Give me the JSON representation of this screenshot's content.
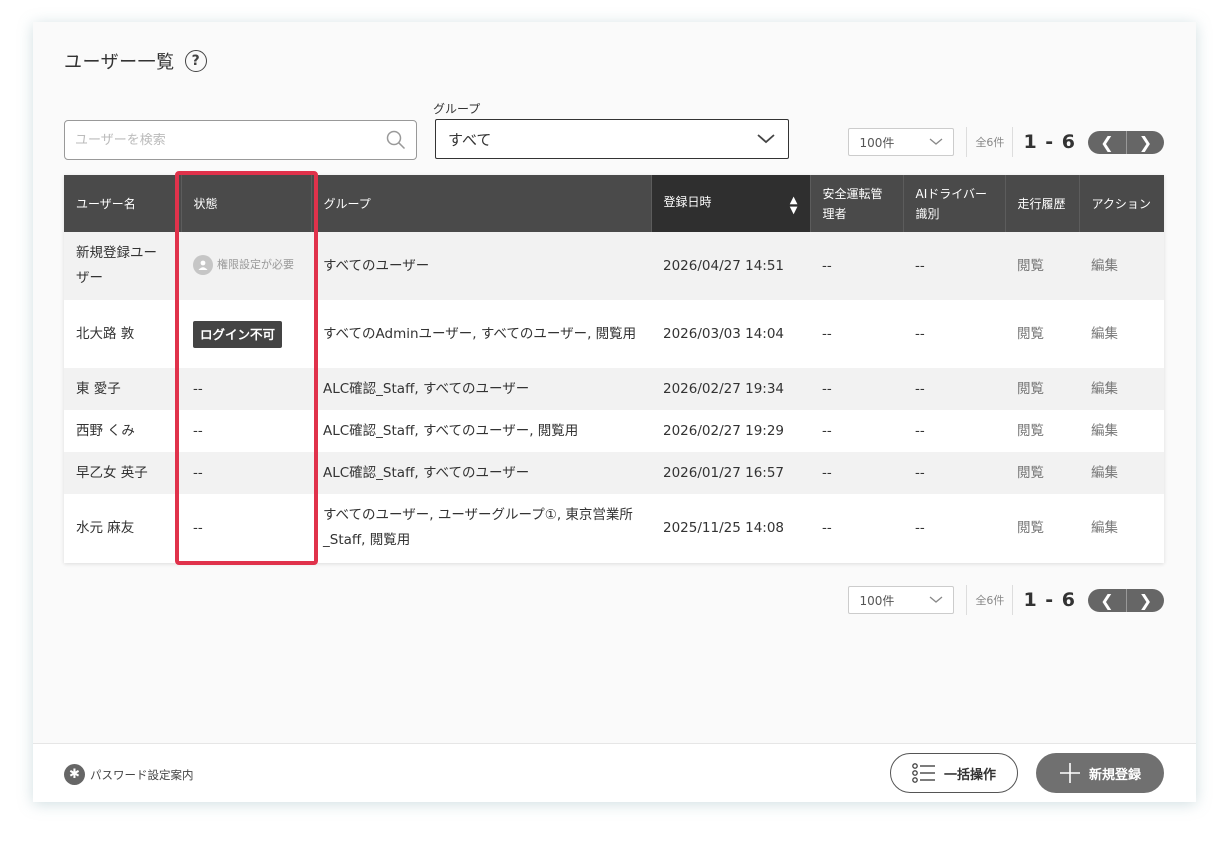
{
  "header": {
    "title": "ユーザー一覧",
    "help_icon": "?"
  },
  "search": {
    "placeholder": "ユーザーを検索"
  },
  "group_filter": {
    "label": "グループ",
    "value": "すべて"
  },
  "pager": {
    "per_page": "100件",
    "total": "全6件",
    "range": "1 - 6",
    "prev": "❮",
    "next": "❯"
  },
  "table": {
    "columns": [
      "ユーザー名",
      "状態",
      "グループ",
      "登録日時",
      "安全運転管理者",
      "AIドライバー識別",
      "走行履歴",
      "アクション"
    ],
    "rows": [
      {
        "name": "新規登録ユーザー",
        "status": "権限設定が必要",
        "group": "すべてのユーザー",
        "date": "2026/04/27 14:51",
        "safety": "--",
        "ai": "--",
        "history": "閲覧",
        "action": "編集"
      },
      {
        "name": "北大路 敦",
        "status": "ログイン不可",
        "group": "すべてのAdminユーザー, すべてのユーザー, 閲覧用",
        "date": "2026/03/03 14:04",
        "safety": "--",
        "ai": "--",
        "history": "閲覧",
        "action": "編集"
      },
      {
        "name": "東 愛子",
        "status": "--",
        "group": "ALC確認_Staff, すべてのユーザー",
        "date": "2026/02/27 19:34",
        "safety": "--",
        "ai": "--",
        "history": "閲覧",
        "action": "編集"
      },
      {
        "name": "西野 くみ",
        "status": "--",
        "group": "ALC確認_Staff, すべてのユーザー, 閲覧用",
        "date": "2026/02/27 19:29",
        "safety": "--",
        "ai": "--",
        "history": "閲覧",
        "action": "編集"
      },
      {
        "name": "早乙女 英子",
        "status": "--",
        "group": "ALC確認_Staff, すべてのユーザー",
        "date": "2026/01/27 16:57",
        "safety": "--",
        "ai": "--",
        "history": "閲覧",
        "action": "編集"
      },
      {
        "name": "水元 麻友",
        "status": "--",
        "group": "すべてのユーザー, ユーザーグループ①, 東京営業所_Staff, 閲覧用",
        "date": "2025/11/25 14:08",
        "safety": "--",
        "ai": "--",
        "history": "閲覧",
        "action": "編集"
      }
    ]
  },
  "footer": {
    "password_guide": "パスワード設定案内",
    "bulk_button": "一括操作",
    "new_button": "新規登録"
  },
  "colors": {
    "highlight": "#e0324b",
    "header_bg": "#4a4a4a",
    "sorted_header_bg": "#2f2f2f",
    "button_gray": "#707070"
  }
}
